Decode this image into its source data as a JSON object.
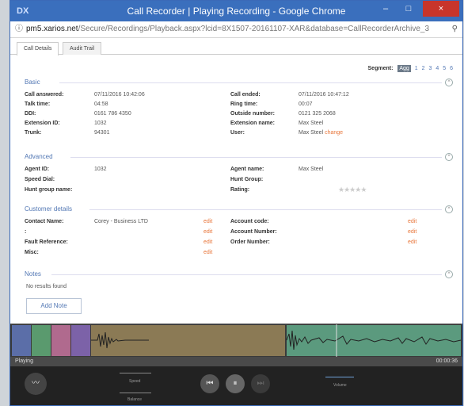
{
  "window": {
    "title": "Call Recorder | Playing Recording - Google Chrome",
    "min": "–",
    "max": "□",
    "close": "×",
    "logo": "DX"
  },
  "address": {
    "host": "pm5.xarios.net",
    "path": "/Secure/Recordings/Playback.aspx?lcid=8X1507-20161107-XAR&database=CallRecorderArchive_3",
    "info_icon": "info-icon",
    "zoom_icon": "zoom-icon"
  },
  "tabs": [
    {
      "label": "Call Details",
      "active": true
    },
    {
      "label": "Audit Trail",
      "active": false
    }
  ],
  "segment": {
    "label": "Segment:",
    "agg": "Agg",
    "numbers": [
      "1",
      "2",
      "3",
      "4",
      "5",
      "6"
    ]
  },
  "basic": {
    "title": "Basic",
    "rows": [
      {
        "l1": "Call answered:",
        "v1": "07/11/2016 10:42:06",
        "l2": "Call ended:",
        "v2": "07/11/2016 10:47:12"
      },
      {
        "l1": "Talk time:",
        "v1": "04:58",
        "l2": "Ring time:",
        "v2": "00:07"
      },
      {
        "l1": "DDI:",
        "v1": "0161 786 4350",
        "l2": "Outside number:",
        "v2": "0121 325 2068"
      },
      {
        "l1": "Extension ID:",
        "v1": "1032",
        "l2": "Extension name:",
        "v2": "Max Steel"
      },
      {
        "l1": "Trunk:",
        "v1": "94301",
        "l2": "User:",
        "v2": "Max Steel"
      }
    ],
    "change_link": "change"
  },
  "advanced": {
    "title": "Advanced",
    "rows": [
      {
        "l1": "Agent ID:",
        "v1": "1032",
        "l2": "Agent name:",
        "v2": "Max Steel"
      },
      {
        "l1": "Speed Dial:",
        "v1": "",
        "l2": "Hunt Group:",
        "v2": ""
      },
      {
        "l1": "Hunt group name:",
        "v1": "",
        "l2": "Rating:",
        "v2": ""
      }
    ],
    "rating": 0,
    "rating_max": 5
  },
  "customer": {
    "title": "Customer details",
    "edit_label": "edit",
    "rows": [
      {
        "l1": "Contact Name:",
        "v1": "Corey - Business LTD",
        "l2": "Account code:"
      },
      {
        "l1": ":",
        "v1": "",
        "l2": "Account Number:"
      },
      {
        "l1": "Fault Reference:",
        "v1": "",
        "l2": "Order Number:"
      },
      {
        "l1": "Misc:",
        "v1": "",
        "l2": ""
      }
    ]
  },
  "notes": {
    "title": "Notes",
    "empty": "No results found",
    "add_button": "Add Note"
  },
  "player": {
    "status": "Playing",
    "time": "00:00:36",
    "speed_label": "Speed",
    "balance_label": "Balance",
    "volume_label": "Volume",
    "segment_colors": [
      "#5b6ea8",
      "#5a9a6e",
      "#b06a8e",
      "#7c62a8",
      "#8b7a55",
      "#5b9a7e"
    ]
  }
}
